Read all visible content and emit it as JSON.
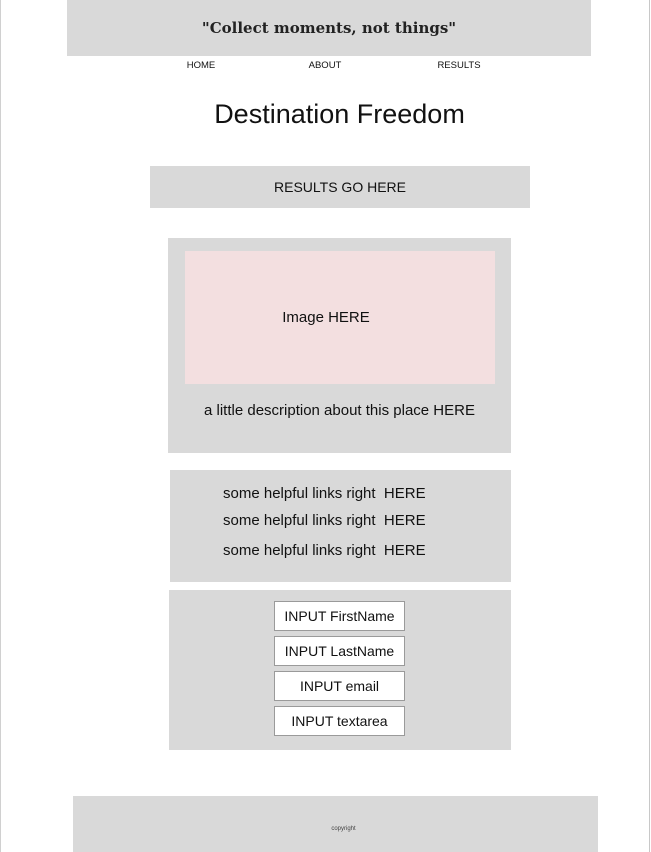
{
  "header": {
    "quote": "\"Collect moments, not things\""
  },
  "nav": {
    "home": "HOME",
    "about": "ABOUT",
    "results": "RESULTS"
  },
  "page_title": "Destination Freedom",
  "results": {
    "label": "RESULTS GO HERE"
  },
  "card": {
    "image_label": "Image HERE",
    "description": "a little description about this place HERE"
  },
  "links": {
    "items": [
      {
        "text": "some helpful links right  ",
        "link": "HERE"
      },
      {
        "text": "some helpful links right  ",
        "link": "HERE"
      },
      {
        "text": "some helpful links right  ",
        "link": "HERE"
      }
    ]
  },
  "form": {
    "first_name": "INPUT FirstName",
    "last_name": "INPUT LastName",
    "email": "INPUT email",
    "textarea": "INPUT textarea"
  },
  "footer": {
    "copyright": "copyright"
  }
}
